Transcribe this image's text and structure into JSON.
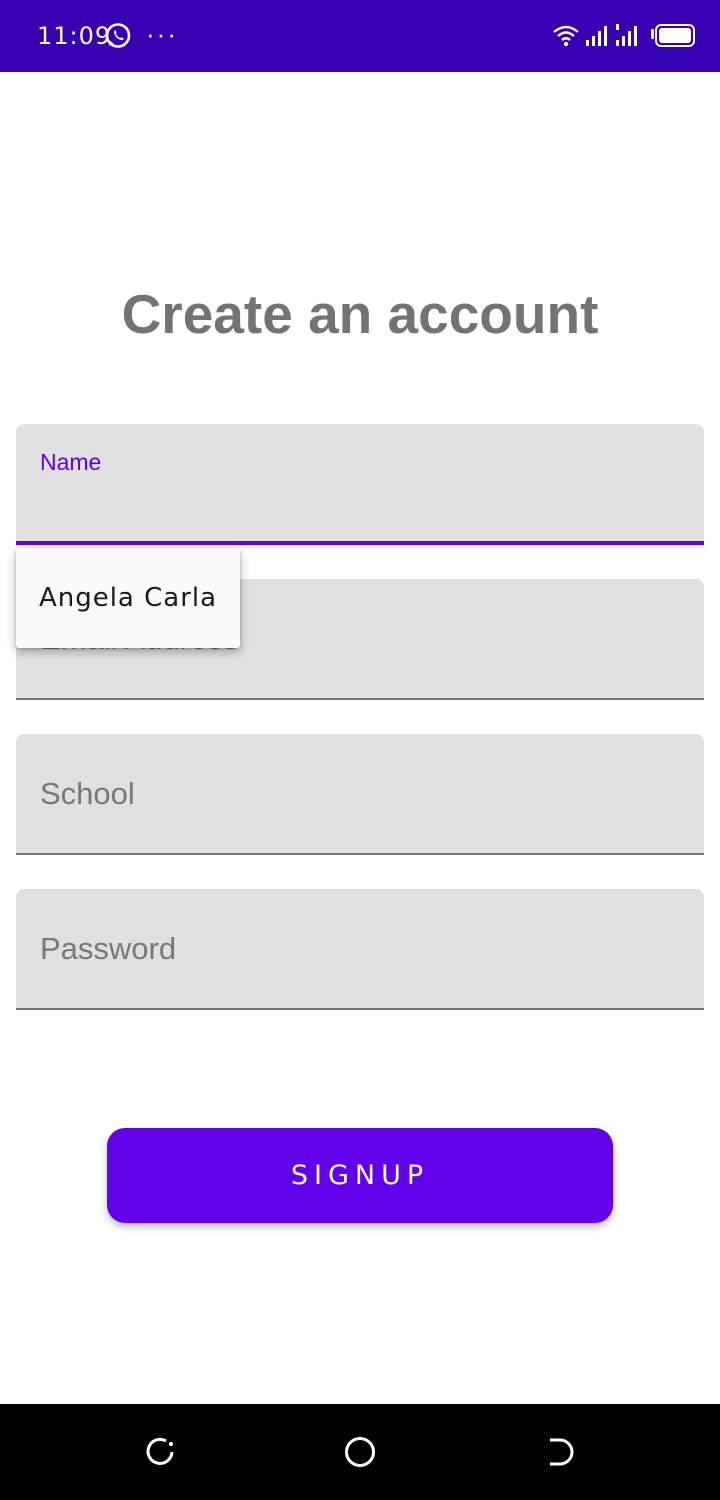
{
  "status_bar": {
    "time": "11:09",
    "more": "···",
    "background": "#3700b3",
    "icons": [
      "whatsapp-icon",
      "wifi-icon",
      "signal-icon",
      "signal-icon",
      "battery-icon"
    ]
  },
  "title": "Create an account",
  "form": {
    "name": {
      "label": "Name",
      "value": ""
    },
    "email": {
      "placeholder": "Email Address"
    },
    "school": {
      "placeholder": "School"
    },
    "password": {
      "placeholder": "Password"
    }
  },
  "autocomplete": {
    "suggestion": "Angela Carla"
  },
  "signup_button": {
    "label": "SIGNUP",
    "color": "#6200ea"
  },
  "nav_bar": {
    "icons": [
      "recent-apps-icon",
      "home-icon",
      "back-icon"
    ]
  }
}
